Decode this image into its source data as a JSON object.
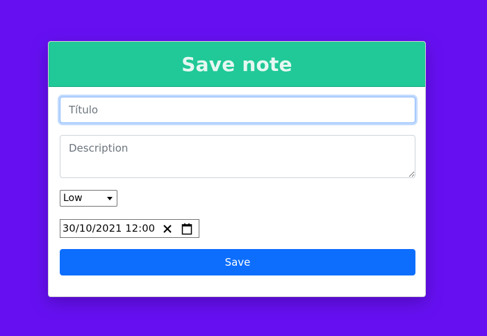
{
  "form": {
    "header_title": "Save note",
    "title_placeholder": "Título",
    "description_placeholder": "Description",
    "priority_selected": "Low",
    "datetime_value": "30/10/2021  12:00",
    "save_label": "Save"
  },
  "colors": {
    "page_background": "#6610f2",
    "header_background": "#20c997",
    "primary_button": "#0d6efd"
  },
  "icons": {
    "clear": "close-icon",
    "calendar": "calendar-icon",
    "select_arrow": "chevron-down-icon"
  }
}
